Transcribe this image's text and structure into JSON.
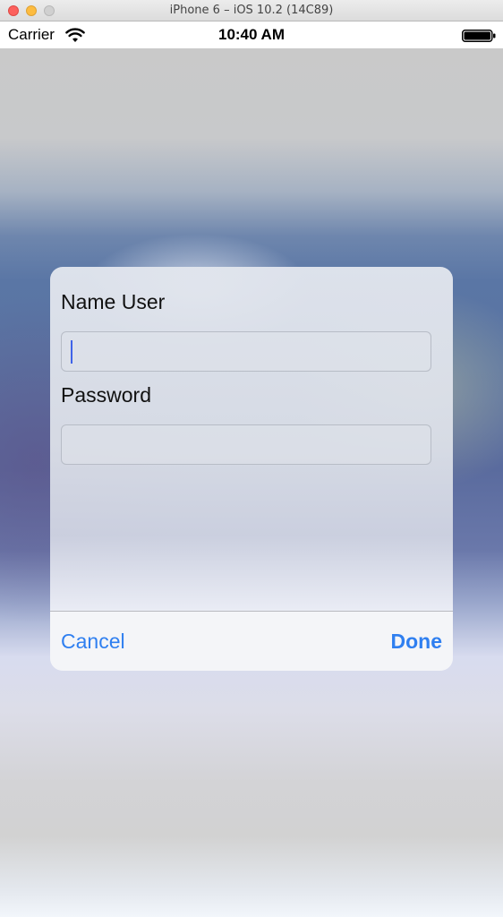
{
  "window": {
    "title": "iPhone 6 – iOS 10.2 (14C89)"
  },
  "status_bar": {
    "carrier": "Carrier",
    "time": "10:40 AM",
    "icons": [
      "wifi-icon",
      "battery-icon"
    ]
  },
  "alert": {
    "name_label": "Name User",
    "name_value": "",
    "password_label": "Password",
    "password_value": "",
    "cancel_label": "Cancel",
    "done_label": "Done"
  },
  "colors": {
    "tint": "#2f7ff0",
    "caret": "#3f63e8",
    "close": "#fc605c",
    "minimize": "#fdbc40"
  }
}
